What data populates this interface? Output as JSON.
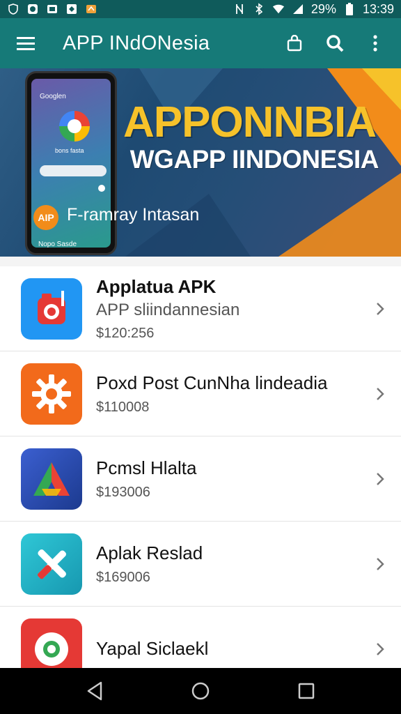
{
  "status_bar": {
    "battery": "29%",
    "time": "13:39",
    "left_icons": [
      "shield-icon",
      "whatsapp-icon",
      "image-icon",
      "facebook-icon",
      "bag-icon"
    ],
    "right_icons": [
      "nfc-icon",
      "bluetooth-icon",
      "wifi-icon",
      "signal-icon",
      "battery-icon"
    ]
  },
  "app_bar": {
    "title": "APP INdONesia",
    "menu_icon": "hamburger-icon",
    "actions": [
      "shopping-bag-icon",
      "search-icon",
      "more-vert-icon"
    ]
  },
  "banner": {
    "headline": "APPONNBIA",
    "subheadline": "WGAPP IINDONESIA",
    "badge": "AIP",
    "tagline": "F-ramray Intasan",
    "phone": {
      "header": "Googlen",
      "subtext": "bons fasta",
      "footer": "Nopo Sasde"
    }
  },
  "apps": [
    {
      "title": "Applatua APK",
      "subtitle": "APP sliindannesian",
      "price": "$120:256",
      "icon": "camera-icon",
      "icon_bg": "#2196f3"
    },
    {
      "title": "Poxd Post CunNha lindeadia",
      "price": "$110008",
      "icon": "gear-icon",
      "icon_bg": "#f26a1b"
    },
    {
      "title": "Pcmsl Hlalta",
      "price": "$193006",
      "icon": "triangle-logo-icon",
      "icon_bg": "#2a4aa8"
    },
    {
      "title": "Aplak Reslad",
      "price": "$169006",
      "icon": "tools-icon",
      "icon_bg": "#1fb8c8"
    },
    {
      "title": "Yapal Siclaekl",
      "icon": "chrome-icon",
      "icon_bg": "#e53935"
    }
  ],
  "nav_bar": {
    "buttons": [
      "back-icon",
      "home-icon",
      "recents-icon"
    ]
  }
}
